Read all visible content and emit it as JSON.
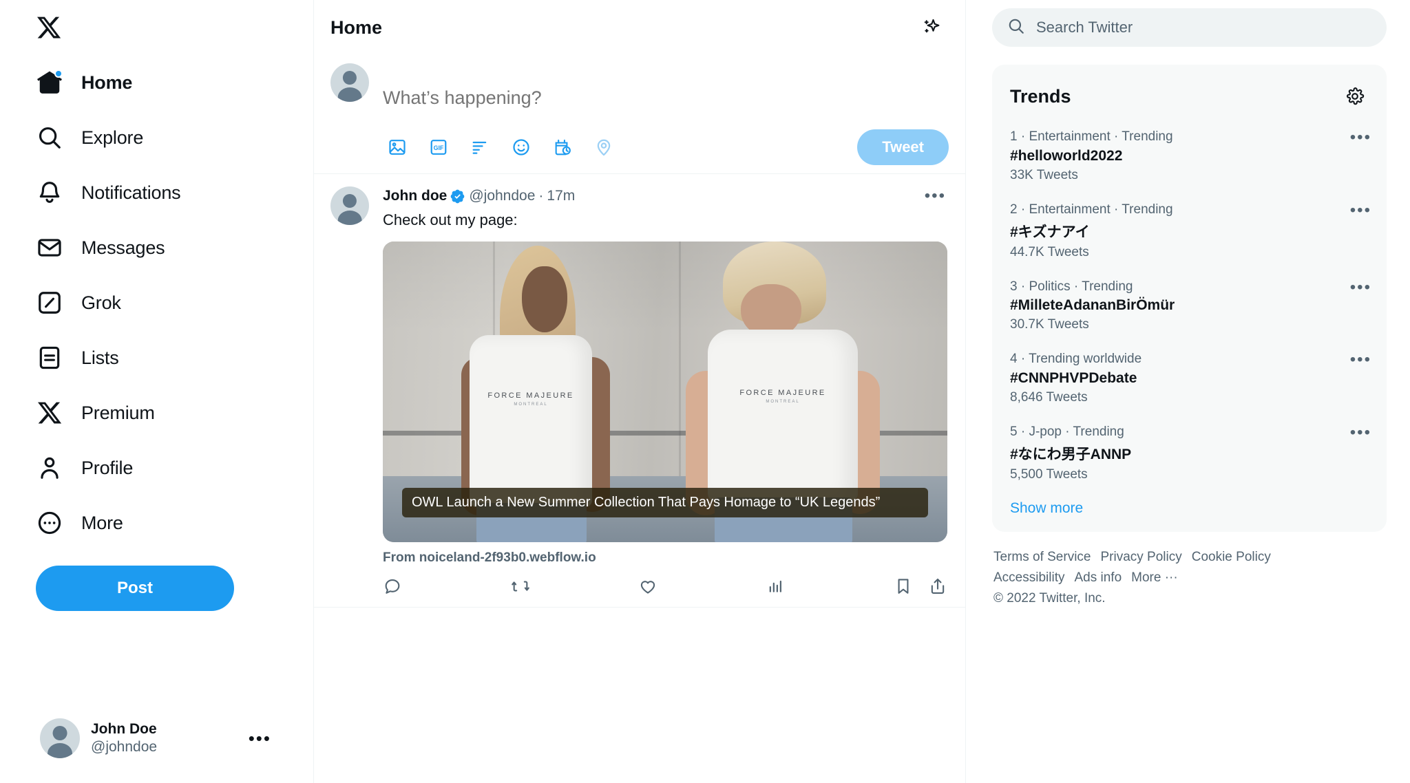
{
  "colors": {
    "accent": "#1d9bf0",
    "text_primary": "#0f1419",
    "text_secondary": "#536471",
    "border": "#eff3f4",
    "panel_bg": "#f7f9f9",
    "search_bg": "#eff3f4",
    "tweet_btn_disabled": "#8ecdf8",
    "caption_bg": "#28210c"
  },
  "sidebar": {
    "logo_icon": "x-logo-icon",
    "items": [
      {
        "label": "Home",
        "icon": "home-icon",
        "active": true,
        "badge": true
      },
      {
        "label": "Explore",
        "icon": "search-icon",
        "active": false,
        "badge": false
      },
      {
        "label": "Notifications",
        "icon": "bell-icon",
        "active": false,
        "badge": false
      },
      {
        "label": "Messages",
        "icon": "envelope-icon",
        "active": false,
        "badge": false
      },
      {
        "label": "Grok",
        "icon": "grok-icon",
        "active": false,
        "badge": false
      },
      {
        "label": "Lists",
        "icon": "lists-icon",
        "active": false,
        "badge": false
      },
      {
        "label": "Premium",
        "icon": "x-premium-icon",
        "active": false,
        "badge": false
      },
      {
        "label": "Profile",
        "icon": "person-icon",
        "active": false,
        "badge": false
      },
      {
        "label": "More",
        "icon": "more-circle-icon",
        "active": false,
        "badge": false
      }
    ],
    "post_button": "Post",
    "account": {
      "name": "John Doe",
      "handle": "@johndoe",
      "menu_glyph": "•••"
    }
  },
  "main": {
    "title": "Home",
    "sparkle_icon": "sparkle-icon",
    "compose": {
      "placeholder": "What’s happening?",
      "value": "",
      "tools": [
        {
          "icon": "image-icon",
          "name": "add-media"
        },
        {
          "icon": "gif-icon",
          "name": "add-gif"
        },
        {
          "icon": "poll-icon",
          "name": "add-poll"
        },
        {
          "icon": "emoji-icon",
          "name": "add-emoji"
        },
        {
          "icon": "schedule-icon",
          "name": "schedule-post"
        },
        {
          "icon": "location-icon",
          "name": "add-location"
        }
      ],
      "submit_label": "Tweet"
    },
    "tweet": {
      "author_name": "John doe",
      "verified": true,
      "handle": "@johndoe",
      "separator": "·",
      "timestamp": "17m",
      "more_glyph": "•••",
      "text": "Check out my page:",
      "card": {
        "caption": "OWL Launch a New Summer Collection That Pays Homage to “UK Legends”",
        "source": "From noiceland-2f93b0.webflow.io",
        "shirt_text": "FORCE MAJEURE",
        "shirt_subtext": "MONTREAL"
      },
      "actions": [
        {
          "icon": "reply-icon",
          "label": ""
        },
        {
          "icon": "retweet-icon",
          "label": ""
        },
        {
          "icon": "like-icon",
          "label": ""
        },
        {
          "icon": "views-icon",
          "label": ""
        },
        {
          "icon": "bookmark-icon",
          "label": ""
        },
        {
          "icon": "share-icon",
          "label": ""
        }
      ]
    }
  },
  "right": {
    "search": {
      "placeholder": "Search Twitter",
      "value": "",
      "icon": "search-icon"
    },
    "trends": {
      "title": "Trends",
      "settings_icon": "gear-icon",
      "more_glyph": "•••",
      "items": [
        {
          "meta": "1 · Entertainment · Trending",
          "name": "#helloworld2022",
          "count": "33K Tweets"
        },
        {
          "meta": "2 · Entertainment · Trending",
          "name": "#キズナアイ",
          "count": "44.7K Tweets"
        },
        {
          "meta": "3 · Politics · Trending",
          "name": "#MilleteAdananBirÖmür",
          "count": "30.7K Tweets"
        },
        {
          "meta": "4 · Trending worldwide",
          "name": "#CNNPHVPDebate",
          "count": "8,646 Tweets"
        },
        {
          "meta": "5 · J-pop · Trending",
          "name": "#なにわ男子ANNP",
          "count": "5,500 Tweets"
        }
      ],
      "show_more": "Show more"
    },
    "footer": {
      "row1": [
        "Terms of Service",
        "Privacy Policy",
        "Cookie Policy"
      ],
      "row2": [
        "Accessibility",
        "Ads info",
        "More ···"
      ],
      "copyright": "© 2022 Twitter, Inc."
    }
  }
}
